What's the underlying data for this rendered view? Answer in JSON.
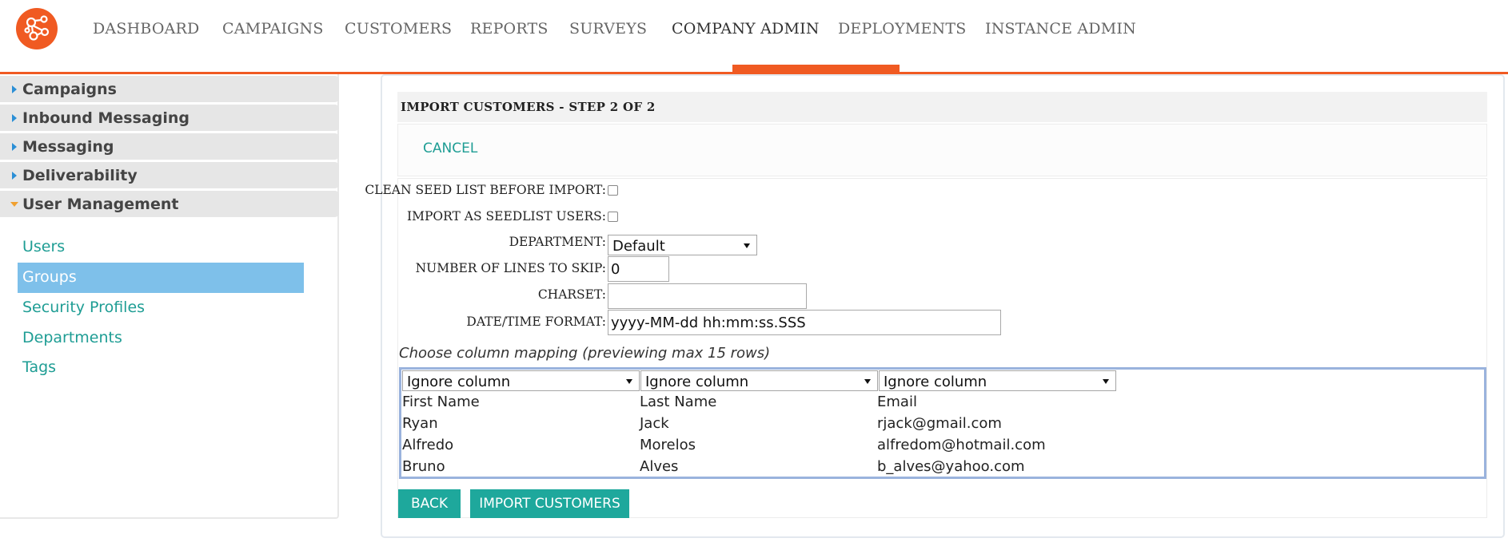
{
  "brand": {
    "accent": "#f05a22",
    "teal": "#1ea89c",
    "link": "#1e9d94",
    "selected": "#7ec0ea"
  },
  "nav": {
    "logo_icon": "network-logo-icon",
    "items": [
      {
        "label": "DASHBOARD"
      },
      {
        "label": "CAMPAIGNS"
      },
      {
        "label": "CUSTOMERS"
      },
      {
        "label": "REPORTS"
      },
      {
        "label": "SURVEYS"
      },
      {
        "label": "COMPANY ADMIN",
        "active": true
      },
      {
        "label": "DEPLOYMENTS"
      },
      {
        "label": "INSTANCE ADMIN"
      }
    ]
  },
  "sidebar": {
    "sections": [
      {
        "label": "Campaigns",
        "expanded": false
      },
      {
        "label": "Inbound Messaging",
        "expanded": false
      },
      {
        "label": "Messaging",
        "expanded": false
      },
      {
        "label": "Deliverability",
        "expanded": false
      },
      {
        "label": "User Management",
        "expanded": true
      }
    ],
    "items": [
      {
        "label": "Users"
      },
      {
        "label": "Groups",
        "selected": true
      },
      {
        "label": "Security Profiles"
      },
      {
        "label": "Departments"
      },
      {
        "label": "Tags"
      }
    ]
  },
  "main": {
    "title": "IMPORT CUSTOMERS - STEP 2 OF 2",
    "cancel_label": "CANCEL",
    "form": {
      "clean_seed_label": "CLEAN SEED LIST BEFORE IMPORT:",
      "clean_seed_checked": false,
      "import_seed_label": "IMPORT AS SEEDLIST USERS:",
      "import_seed_checked": false,
      "department_label": "DEPARTMENT:",
      "department_value": "Default",
      "skip_label": "NUMBER OF LINES TO SKIP:",
      "skip_value": "0",
      "charset_label": "CHARSET:",
      "charset_value": "",
      "datetime_label": "DATE/TIME FORMAT:",
      "datetime_value": "yyyy-MM-dd hh:mm:ss.SSS"
    },
    "mapping": {
      "title": "Choose column mapping (previewing max 15 rows)",
      "column_selects": [
        "Ignore column",
        "Ignore column",
        "Ignore column"
      ],
      "rows": [
        [
          "First Name",
          "Last Name",
          "Email"
        ],
        [
          "Ryan",
          "Jack",
          "rjack@gmail.com"
        ],
        [
          "Alfredo",
          "Morelos",
          "alfredom@hotmail.com"
        ],
        [
          "Bruno",
          "Alves",
          "b_alves@yahoo.com"
        ]
      ]
    },
    "buttons": {
      "back": "BACK",
      "import": "IMPORT CUSTOMERS"
    }
  }
}
